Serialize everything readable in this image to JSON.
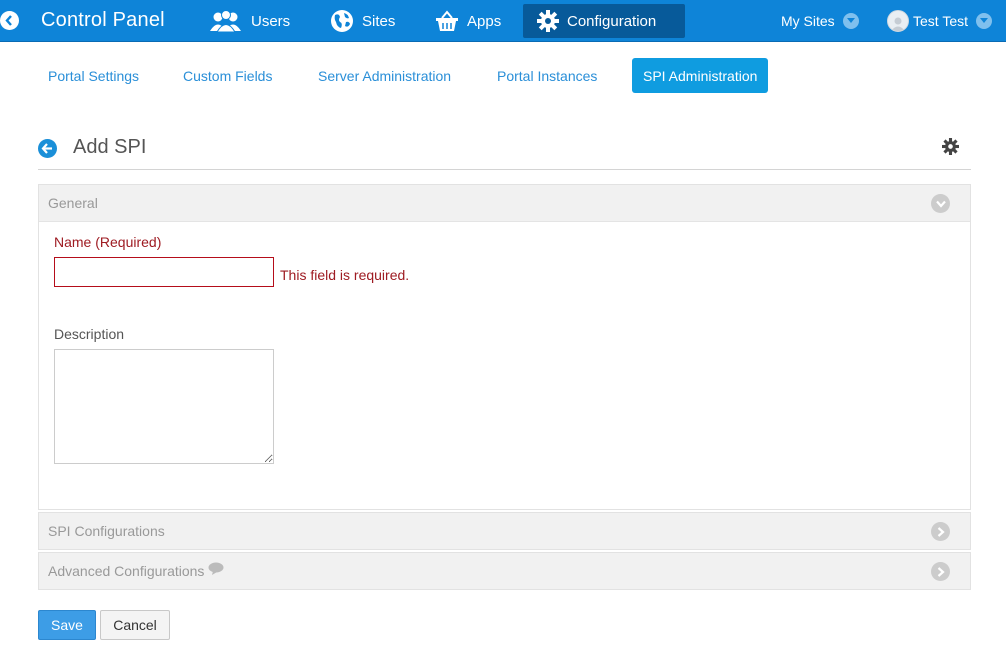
{
  "topbar": {
    "title": "Control Panel",
    "nav": [
      {
        "label": "Users",
        "icon": "users-icon"
      },
      {
        "label": "Sites",
        "icon": "globe-icon"
      },
      {
        "label": "Apps",
        "icon": "basket-icon"
      },
      {
        "label": "Configuration",
        "icon": "gear-icon"
      }
    ],
    "my_sites": "My Sites",
    "user": "Test Test"
  },
  "subtabs": [
    "Portal Settings",
    "Custom Fields",
    "Server Administration",
    "Portal Instances",
    "SPI Administration"
  ],
  "active_subtab": "SPI Administration",
  "page": {
    "title": "Add SPI"
  },
  "general": {
    "header": "General",
    "name_label": "Name (Required)",
    "name_value": "",
    "name_error": "This field is required.",
    "description_label": "Description",
    "description_value": ""
  },
  "panels": {
    "spi_configurations": "SPI Configurations",
    "advanced_configurations": "Advanced Configurations"
  },
  "actions": {
    "save": "Save",
    "cancel": "Cancel"
  },
  "colors": {
    "topbar": "#0e84d8",
    "active_nav": "#075a9a",
    "accent": "#0f9ce0",
    "error": "#9e1b22"
  }
}
